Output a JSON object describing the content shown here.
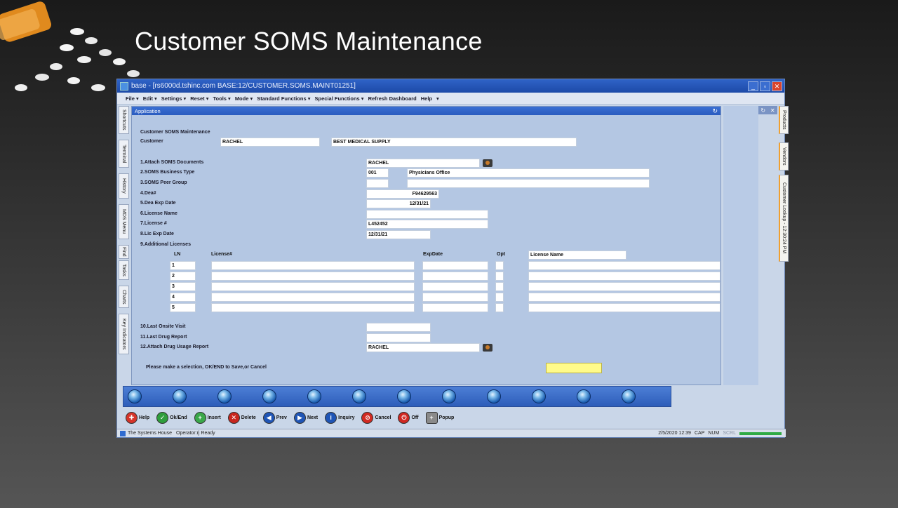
{
  "slide": {
    "title": "Customer SOMS Maintenance"
  },
  "window": {
    "title": "base - [rs6000d.tshinc.com BASE:12/CUSTOMER.SOMS.MAINT01251]",
    "menu": [
      "File ▾",
      "Edit ▾",
      "Settings ▾",
      "Reset ▾",
      "Tools ▾",
      "Mode ▾",
      "Standard Functions ▾",
      "Special Functions ▾",
      "Refresh Dashboard",
      "Help",
      "▾"
    ],
    "left_tabs": [
      "Shortcuts",
      "Terminal",
      "History",
      "MDS Menu",
      "Find",
      "Tasks",
      "Charts",
      "Key Indicators"
    ],
    "right_tabs": [
      "Products",
      "Vendors",
      "Customer Lookup - 12:30:24 PM"
    ]
  },
  "app": {
    "header": "Application",
    "form_title": "Customer SOMS Maintenance",
    "customer_label": "Customer",
    "customer_id": "RACHEL",
    "customer_name": "BEST MEDICAL SUPPLY",
    "fields": {
      "f1_label": "1.Attach SOMS Documents",
      "f1_value": "RACHEL",
      "f2_label": "2.SOMS Business Type",
      "f2_code": "001",
      "f2_desc": "Physicians Office",
      "f3_label": "3.SOMS Peer Group",
      "f4_label": "4.Dea#",
      "f4_value": "F94629563",
      "f5_label": "5.Dea Exp Date",
      "f5_value": "12/31/21",
      "f6_label": "6.License Name",
      "f7_label": "7.License #",
      "f7_value": "L452452",
      "f8_label": "8.Lic Exp Date",
      "f8_value": "12/31/21",
      "f9_label": "9.Additional Licenses",
      "f10_label": "10.Last Onsite Visit",
      "f11_label": "11.Last Drug Report",
      "f12_label": "12.Attach Drug Usage Report",
      "f12_value": "RACHEL"
    },
    "licenses_table": {
      "headers": {
        "ln": "LN",
        "license": "License#",
        "expdate": "ExpDate",
        "opt": "Opt",
        "name": "License Name"
      },
      "rows": [
        "1",
        "2",
        "3",
        "4",
        "5"
      ]
    },
    "prompt": "Please make a selection, OK/END to Save,or Cancel"
  },
  "toolbar": {
    "buttons": [
      {
        "label": "Help",
        "icon": "help-icon"
      },
      {
        "label": "Ok/End",
        "icon": "check-icon"
      },
      {
        "label": "Insert",
        "icon": "plus-icon"
      },
      {
        "label": "Delete",
        "icon": "x-icon"
      },
      {
        "label": "Prev",
        "icon": "rewind-icon"
      },
      {
        "label": "Next",
        "icon": "fast-forward-icon"
      },
      {
        "label": "Inquiry",
        "icon": "info-icon"
      },
      {
        "label": "Cancel",
        "icon": "cancel-icon"
      },
      {
        "label": "Off",
        "icon": "power-icon"
      },
      {
        "label": "Popup",
        "icon": "popup-icon"
      }
    ]
  },
  "statusbar": {
    "company": "The Systems House",
    "status": "Operator:rj Ready",
    "datetime": "2/5/2020 12:39",
    "cap": "CAP",
    "num": "NUM",
    "scrl": "SCRL"
  }
}
